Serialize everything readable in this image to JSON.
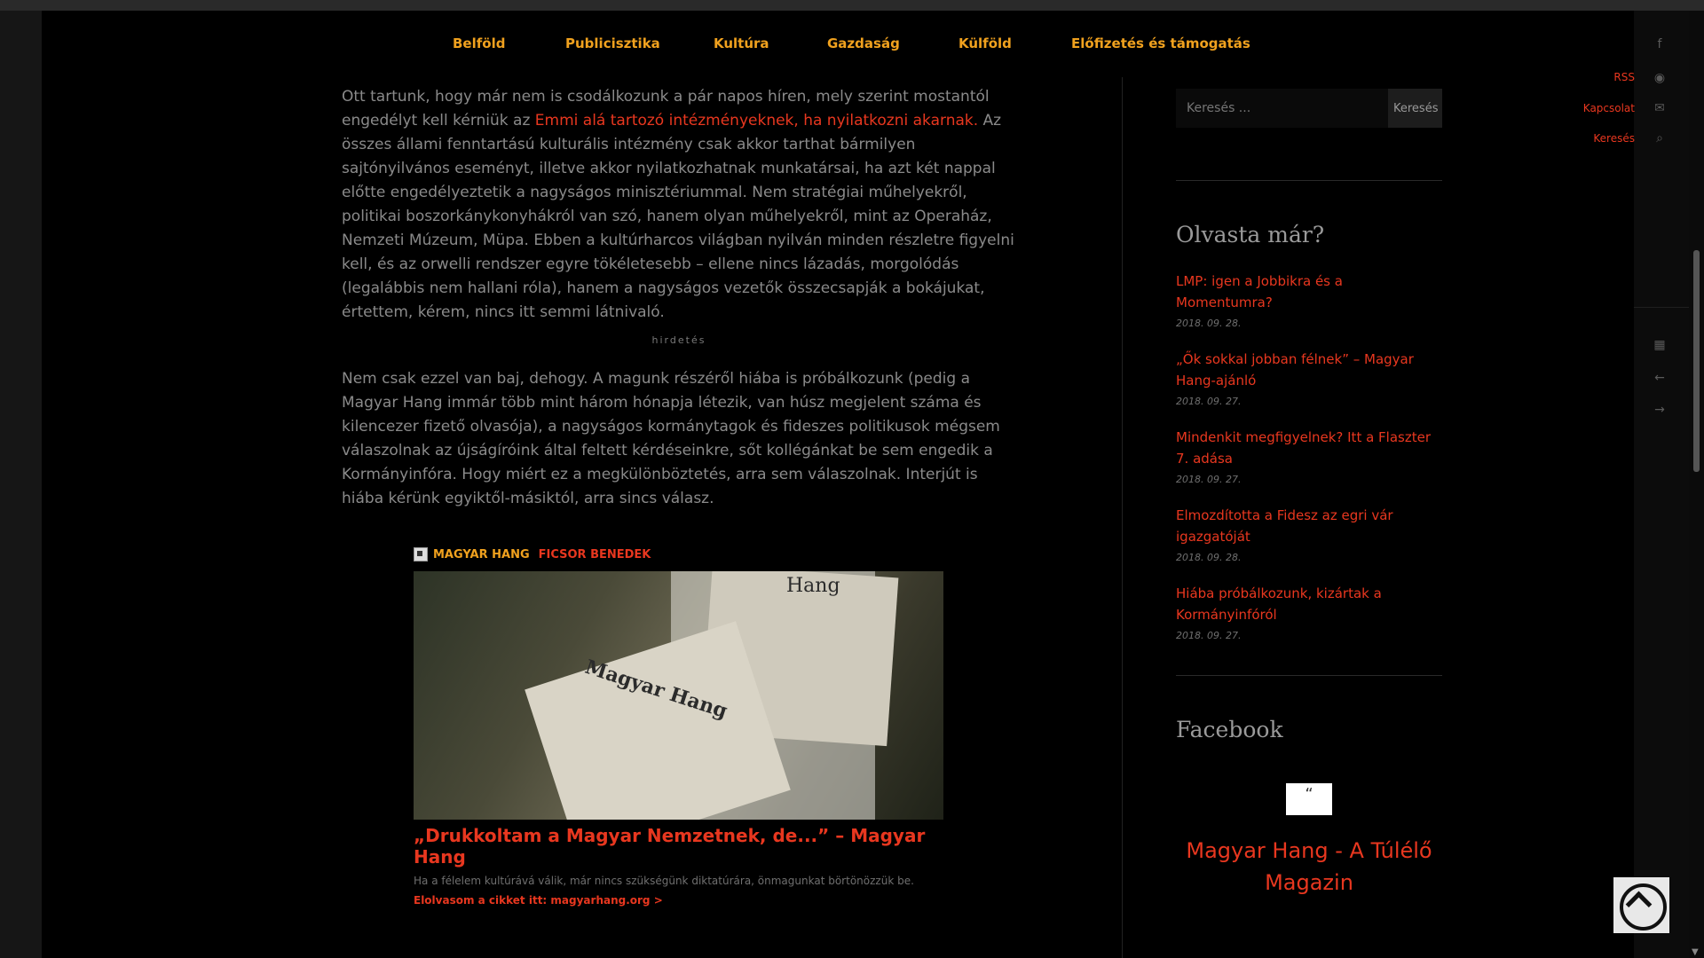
{
  "nav": {
    "items": [
      "Belföld",
      "Publicisztika",
      "Kultúra",
      "Gazdaság",
      "Külföld",
      "Előfizetés és támogatás"
    ]
  },
  "article": {
    "p1_before": "Ott tartunk, hogy már nem is csodálkozunk a pár napos híren, mely szerint mostantól engedélyt kell kérniük az ",
    "p1_link": "Emmi alá tartozó intézményeknek, ha nyilatkozni akarnak.",
    "p1_after": " Az összes állami fenntartású kulturális intézmény csak akkor tarthat bármilyen sajtónyilvános eseményt, illetve akkor nyilatkozhatnak munkatársai, ha azt két nappal előtte engedélyeztetik a nagyságos minisztériummal. Nem stratégiai műhelyekről, politikai boszorkánykonyhákról van szó, hanem olyan műhelyekről, mint az Operaház, Nemzeti Múzeum, Müpa. Ebben a kultúrharcos világban nyilván minden részletre figyelni kell, és az orwelli rendszer egyre tökéletesebb – ellene nincs lázadás, morgolódás (legalábbis nem hallani róla), hanem a nagyságos vezetők összecsapják a bokájukat, értettem, kérem, nincs itt semmi látnivaló.",
    "ad_label": "hirdetés",
    "p2": "Nem csak ezzel van baj, dehogy. A magunk részéről hiába is próbálkozunk (pedig a Magyar Hang immár több mint három hónapja létezik, van húsz megjelent száma és kilencezer fizető olvasója), a nagyságos kormánytagok és fideszes politikusok mégsem válaszolnak az újságíróink által feltett kérdéseinkre, sőt kollégánkat be sem engedik a Kormányinfóra. Hogy miért ez a megkülönböztetés, arra sem válaszolnak. Interjút is hiába kérünk egyiktől-másiktól, arra sincs válasz."
  },
  "card": {
    "site": "MAGYAR HANG",
    "author": "FICSOR BENEDEK",
    "newspaper_title": "Magyar Hang",
    "newspaper_title2": "Hang",
    "title": "„Drukkoltam a Magyar Nemzetnek, de...” – Magyar Hang",
    "desc": "Ha a félelem kultúrává válik, már nincs szükségünk diktatúrára, önmagunkat börtönözzük be.",
    "link": "Elolvasom a cikket itt: magyarhang.org >"
  },
  "sidebar": {
    "search_placeholder": "Keresés ...",
    "search_button": "Keresés",
    "read_title": "Olvasta már?",
    "posts": [
      {
        "title": "LMP: igen a Jobbikra és a Momentumra?",
        "date": "2018. 09. 28."
      },
      {
        "title": "„Ők sokkal jobban félnek” – Magyar Hang-ajánló",
        "date": "2018. 09. 27."
      },
      {
        "title": "Mindenkit megfigyelnek? Itt a Flaszter 7. adása",
        "date": "2018. 09. 27."
      },
      {
        "title": "Elmozdította a Fidesz az egri vár igazgatóját",
        "date": "2018. 09. 28."
      },
      {
        "title": "Hiába próbálkozunk, kizártak a Kormányinfóról",
        "date": "2018. 09. 27."
      }
    ],
    "facebook_title": "Facebook",
    "facebook_quote": "“",
    "facebook_page": "Magyar Hang - A Túlélő Magazin"
  },
  "rightbar": {
    "rss": "RSS",
    "contact": "Kapcsolat",
    "search": "Keresés"
  },
  "colors": {
    "accent_orange": "#f0a11e",
    "accent_red": "#e8371f"
  }
}
